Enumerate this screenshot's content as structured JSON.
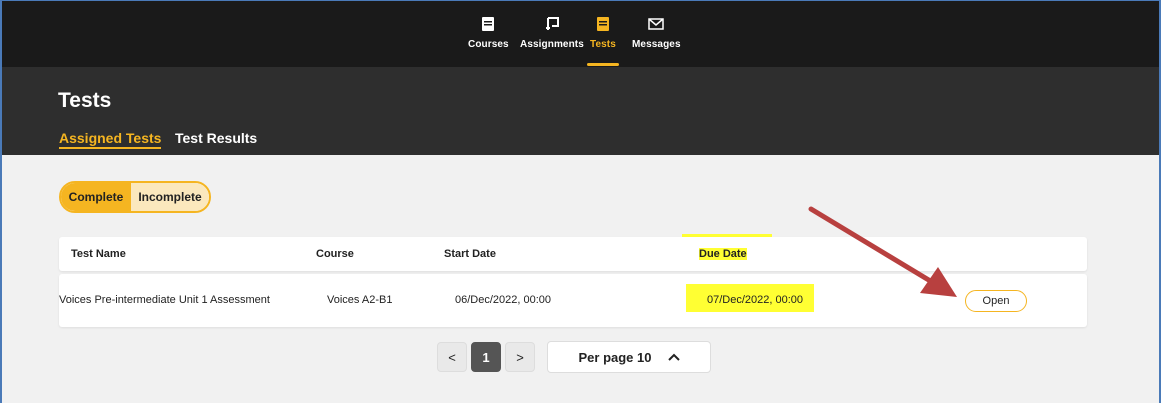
{
  "nav": {
    "items": [
      {
        "label": "Courses",
        "icon": "courses-icon"
      },
      {
        "label": "Assignments",
        "icon": "assignments-icon"
      },
      {
        "label": "Tests",
        "icon": "tests-icon",
        "active": true
      },
      {
        "label": "Messages",
        "icon": "messages-icon"
      }
    ]
  },
  "header": {
    "title": "Tests",
    "tabs": [
      {
        "label": "Assigned Tests",
        "active": true
      },
      {
        "label": "Test Results"
      }
    ]
  },
  "filter": {
    "complete_label": "Complete",
    "incomplete_label": "Incomplete",
    "selected": "Complete"
  },
  "table": {
    "columns": [
      "Test Name",
      "Course",
      "Start Date",
      "Due Date"
    ],
    "rows": [
      {
        "test_name": "Voices Pre-intermediate Unit 1 Assessment",
        "course": "Voices A2-B1",
        "start_date": "06/Dec/2022, 00:00",
        "due_date": "07/Dec/2022, 00:00",
        "action": "Open"
      }
    ]
  },
  "pagination": {
    "prev": "<",
    "current_page": "1",
    "next": ">",
    "per_page_label": "Per page 10"
  },
  "colors": {
    "accent": "#f5b521",
    "highlight": "#ffff33",
    "annotation_arrow": "#b8403f",
    "nav_bg": "#1a1a1a",
    "header_bg": "#2e2e2e"
  }
}
